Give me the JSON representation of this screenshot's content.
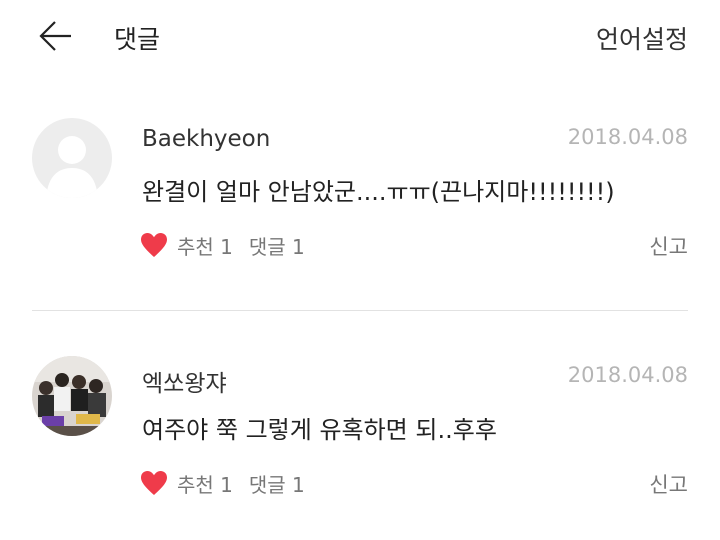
{
  "header": {
    "back_icon": "arrow-left-icon",
    "title": "댓글",
    "language_settings": "언어설정"
  },
  "comments": [
    {
      "author": "Baekhyeon",
      "date": "2018.04.08",
      "text": "완결이 얼마 안남았군....ㅠㅠ(끈나지마!!!!!!!!)",
      "like_label": "추천 1",
      "reply_label": "댓글 1",
      "report_label": "신고",
      "avatar": "default-avatar"
    },
    {
      "author": "엑쏘왕쟈",
      "date": "2018.04.08",
      "text": "여주야 쭉 그렇게 유혹하면 되..후후",
      "like_label": "추천 1",
      "reply_label": "댓글 1",
      "report_label": "신고",
      "avatar": "group-photo-avatar"
    }
  ],
  "colors": {
    "heart": "#ef3b4a",
    "date": "#b5b5b5",
    "divider": "#e2e2e2"
  }
}
